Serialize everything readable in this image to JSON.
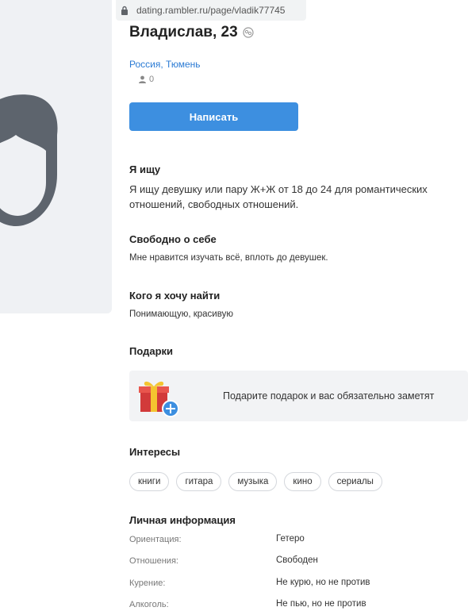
{
  "browser": {
    "url": "dating.rambler.ru/page/vladik77745"
  },
  "profile": {
    "name_age": "Владислав, 23",
    "location": "Россия, Тюмень",
    "followers": "0",
    "write_button": "Написать"
  },
  "seeking": {
    "title": "Я ищу",
    "text": "Я ищу девушку или пару Ж+Ж от 18 до 24 для романтических отношений, свободных отношений."
  },
  "about": {
    "title": "Свободно о себе",
    "text": "Мне нравится изучать всё, вплоть до девушек."
  },
  "looking_for": {
    "title": "Кого я хочу найти",
    "text": "Понимающую, красивую"
  },
  "gifts": {
    "title": "Подарки",
    "prompt": "Подарите подарок и вас обязательно заметят"
  },
  "interests": {
    "title": "Интересы",
    "tags": [
      "книги",
      "гитара",
      "музыка",
      "кино",
      "сериалы"
    ]
  },
  "personal": {
    "title": "Личная информация",
    "rows": [
      {
        "label": "Ориентация:",
        "value": "Гетеро"
      },
      {
        "label": "Отношения:",
        "value": "Свободен"
      },
      {
        "label": "Курение:",
        "value": "Не курю, но не против"
      },
      {
        "label": "Алкоголь:",
        "value": "Не пью, но не против"
      }
    ]
  },
  "colors": {
    "accent": "#3d8fe0",
    "link": "#2b7bd4",
    "avatar": "#5d646d"
  }
}
